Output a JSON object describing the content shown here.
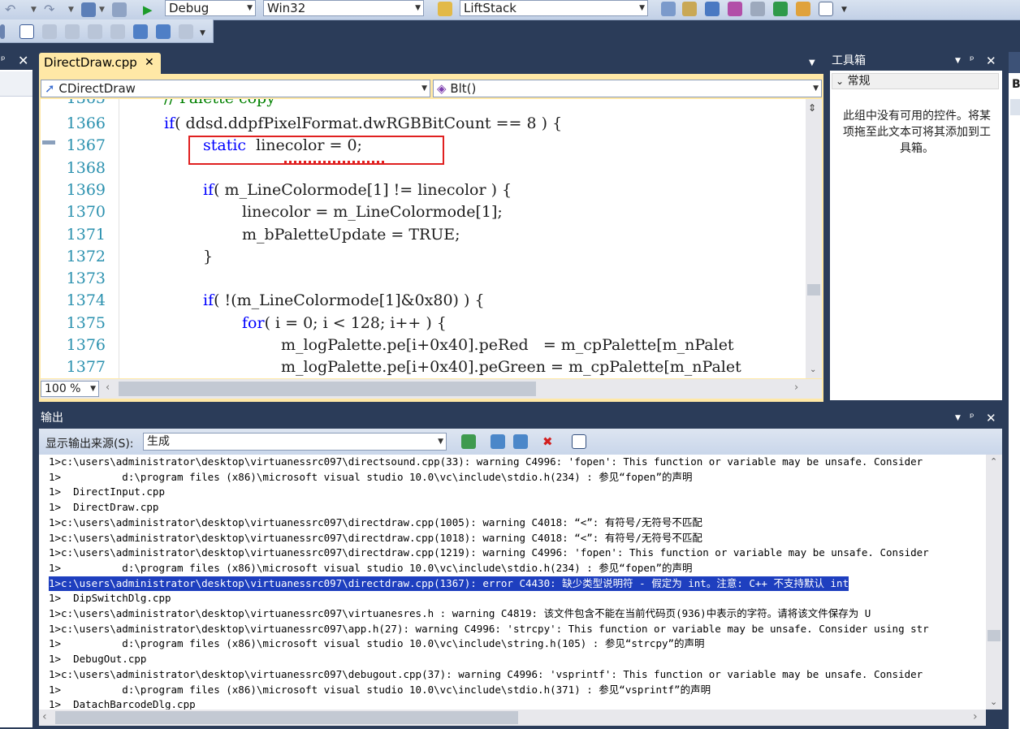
{
  "toolbar1": {
    "config": "Debug",
    "platform": "Win32",
    "project": "LiftStack"
  },
  "editor": {
    "tab_label": "DirectDraw.cpp",
    "class_combo": "CDirectDraw",
    "method_combo": "Blt()",
    "zoom": "100 %",
    "partial_top": "// Palette copy",
    "partial_top_ln": "1365",
    "lines": [
      {
        "ln": "1366",
        "indent": 1,
        "segments": [
          {
            "k": "kw",
            "t": "if"
          },
          {
            "k": "",
            "t": "( ddsd.ddpfPixelFormat.dwRGBBitCount == 8 ) {"
          }
        ]
      },
      {
        "ln": "1367",
        "indent": 2,
        "segments": [
          {
            "k": "kw",
            "t": "static"
          },
          {
            "k": "",
            "t": "  linecolor = 0;"
          }
        ]
      },
      {
        "ln": "1368",
        "indent": 0,
        "segments": []
      },
      {
        "ln": "1369",
        "indent": 2,
        "segments": [
          {
            "k": "kw",
            "t": "if"
          },
          {
            "k": "",
            "t": "( m_LineColormode[1] != linecolor ) {"
          }
        ]
      },
      {
        "ln": "1370",
        "indent": 3,
        "segments": [
          {
            "k": "",
            "t": "linecolor = m_LineColormode[1];"
          }
        ]
      },
      {
        "ln": "1371",
        "indent": 3,
        "segments": [
          {
            "k": "",
            "t": "m_bPaletteUpdate = TRUE;"
          }
        ]
      },
      {
        "ln": "1372",
        "indent": 2,
        "segments": [
          {
            "k": "",
            "t": "}"
          }
        ]
      },
      {
        "ln": "1373",
        "indent": 0,
        "segments": []
      },
      {
        "ln": "1374",
        "indent": 2,
        "segments": [
          {
            "k": "kw",
            "t": "if"
          },
          {
            "k": "",
            "t": "( !(m_LineColormode[1]&0x80) ) {"
          }
        ]
      },
      {
        "ln": "1375",
        "indent": 3,
        "segments": [
          {
            "k": "kw",
            "t": "for"
          },
          {
            "k": "",
            "t": "( i = 0; i < 128; i++ ) {"
          }
        ]
      },
      {
        "ln": "1376",
        "indent": 4,
        "segments": [
          {
            "k": "",
            "t": "m_logPalette.pe[i+0x40].peRed   = m_cpPalette[m_nPalet"
          }
        ]
      },
      {
        "ln": "1377",
        "indent": 4,
        "segments": [
          {
            "k": "",
            "t": "m_logPalette.pe[i+0x40].peGreen = m_cpPalette[m_nPalet"
          }
        ]
      }
    ]
  },
  "toolbox": {
    "title": "工具箱",
    "section": "常规",
    "empty_text": "此组中没有可用的控件。将某项拖至此文本可将其添加到工具箱。"
  },
  "output": {
    "title": "输出",
    "source_label": "显示输出来源(S):",
    "source_value": "生成",
    "lines": [
      "1>c:\\users\\administrator\\desktop\\virtuanessrc097\\directsound.cpp(33): warning C4996: 'fopen': This function or variable may be unsafe. Consider",
      "1>          d:\\program files (x86)\\microsoft visual studio 10.0\\vc\\include\\stdio.h(234) : 参见“fopen”的声明",
      "1>  DirectInput.cpp",
      "1>  DirectDraw.cpp",
      "1>c:\\users\\administrator\\desktop\\virtuanessrc097\\directdraw.cpp(1005): warning C4018: “<”: 有符号/无符号不匹配",
      "1>c:\\users\\administrator\\desktop\\virtuanessrc097\\directdraw.cpp(1018): warning C4018: “<”: 有符号/无符号不匹配",
      "1>c:\\users\\administrator\\desktop\\virtuanessrc097\\directdraw.cpp(1219): warning C4996: 'fopen': This function or variable may be unsafe. Consider",
      "1>          d:\\program files (x86)\\microsoft visual studio 10.0\\vc\\include\\stdio.h(234) : 参见“fopen”的声明",
      "1>c:\\users\\administrator\\desktop\\virtuanessrc097\\directdraw.cpp(1367): error C4430: 缺少类型说明符 - 假定为 int。注意: C++ 不支持默认 int",
      "1>  DipSwitchDlg.cpp",
      "1>c:\\users\\administrator\\desktop\\virtuanessrc097\\virtuanesres.h : warning C4819: 该文件包含不能在当前代码页(936)中表示的字符。请将该文件保存为 U",
      "1>c:\\users\\administrator\\desktop\\virtuanessrc097\\app.h(27): warning C4996: 'strcpy': This function or variable may be unsafe. Consider using str",
      "1>          d:\\program files (x86)\\microsoft visual studio 10.0\\vc\\include\\string.h(105) : 参见“strcpy”的声明",
      "1>  DebugOut.cpp",
      "1>c:\\users\\administrator\\desktop\\virtuanessrc097\\debugout.cpp(37): warning C4996: 'vsprintf': This function or variable may be unsafe. Consider",
      "1>          d:\\program files (x86)\\microsoft visual studio 10.0\\vc\\include\\stdio.h(371) : 参见“vsprintf”的声明",
      "1>  DatachBarcodeDlg.cpp"
    ],
    "selected_index": 8
  },
  "side_glyphs": {
    "right_b": "B"
  }
}
